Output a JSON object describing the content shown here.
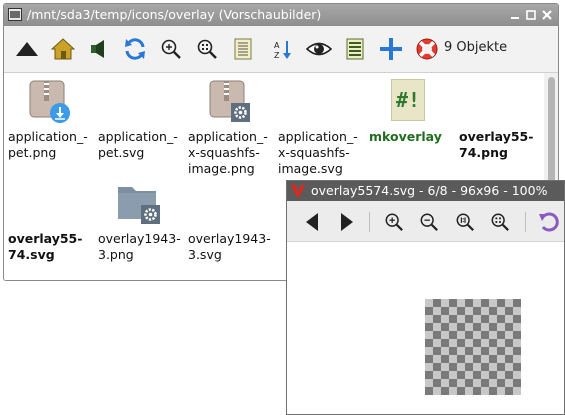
{
  "file_manager": {
    "title": "/mnt/sda3/temp/icons/overlay (Vorschaubilder)",
    "item_count": "9 Objekte",
    "items": [
      {
        "label": "application_-\npet.png",
        "icon": "archive-download-icon",
        "style": "normal"
      },
      {
        "label": "application_-\npet.svg",
        "icon": "none",
        "style": "normal"
      },
      {
        "label": "application_-\nx-squashfs-\nimage.png",
        "icon": "archive-gear-icon",
        "style": "normal"
      },
      {
        "label": "application_-\nx-squashfs-\nimage.svg",
        "icon": "none",
        "style": "normal"
      },
      {
        "label": "mkoverlay",
        "icon": "script-icon",
        "style": "green"
      },
      {
        "label": "overlay55-\n74.png",
        "icon": "none",
        "style": "bold"
      },
      {
        "label": "overlay55-\n74.svg",
        "icon": "none",
        "style": "bold"
      },
      {
        "label": "overlay1943-\n3.png",
        "icon": "folder-gear-icon",
        "style": "normal"
      },
      {
        "label": "overlay1943-\n3.svg",
        "icon": "none",
        "style": "normal"
      }
    ],
    "script_glyph": "#!"
  },
  "viewer": {
    "title": "overlay5574.svg - 6/8 - 96x96 - 100%"
  },
  "colors": {
    "accent_blue": "#2a78d6",
    "script_green": "#2f7a2f",
    "viewer_titlebar": "#5b5b5b"
  }
}
